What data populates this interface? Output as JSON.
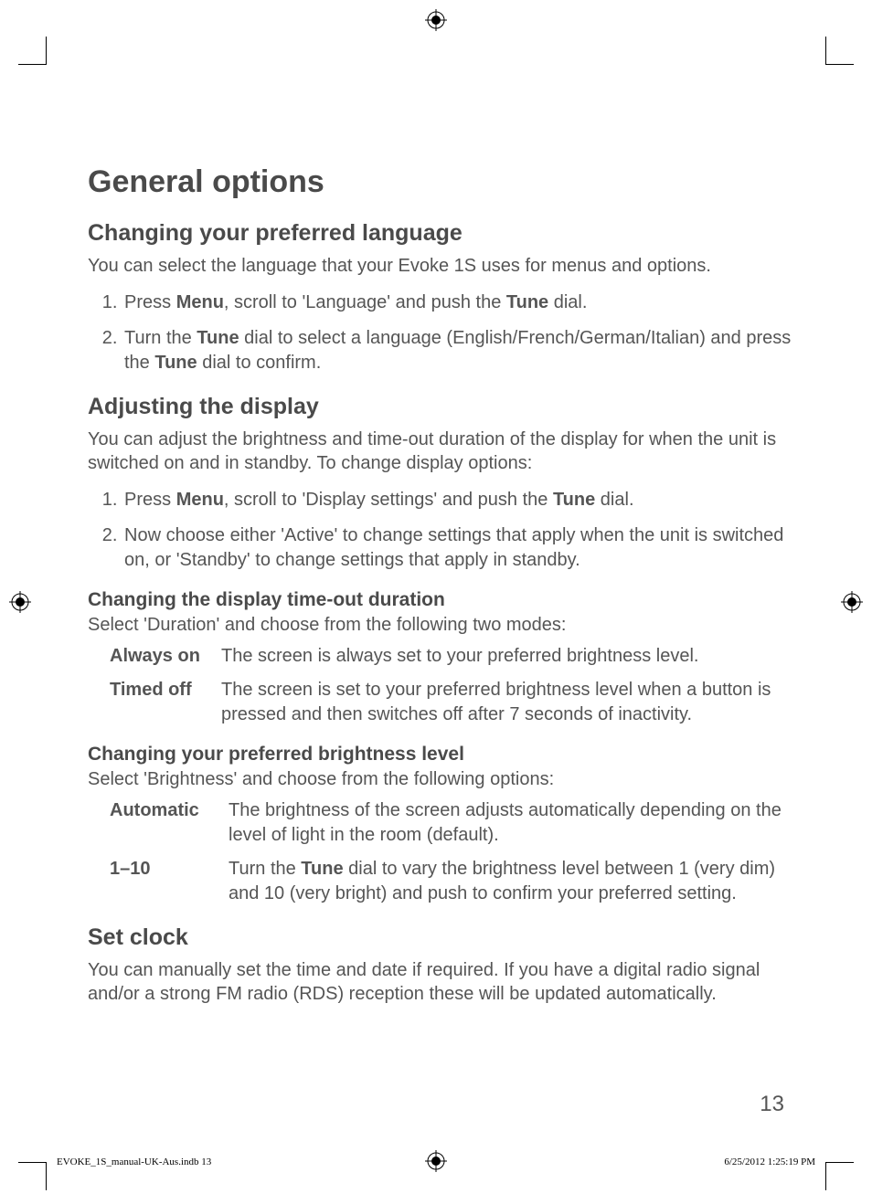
{
  "title": "General options",
  "sections": {
    "lang": {
      "heading": "Changing your preferred language",
      "intro": "You can select the language that your Evoke 1S uses for menus and options.",
      "step1_a": "Press ",
      "step1_b": "Menu",
      "step1_c": ", scroll to 'Language' and push the ",
      "step1_d": "Tune",
      "step1_e": " dial.",
      "step2_a": "Turn the ",
      "step2_b": "Tune",
      "step2_c": " dial to select a language (English/French/German/Italian) and press the ",
      "step2_d": "Tune",
      "step2_e": " dial to confirm."
    },
    "display": {
      "heading": "Adjusting the display",
      "intro": "You can adjust the brightness and time-out duration of the display for when the unit is switched on and in standby. To change display options:",
      "step1_a": "Press ",
      "step1_b": "Menu",
      "step1_c": ", scroll to 'Display settings' and push the ",
      "step1_d": "Tune",
      "step1_e": " dial.",
      "step2": "Now choose either 'Active' to change settings that apply when the unit is switched on, or 'Standby' to change settings that apply in standby.",
      "timeout_heading": "Changing the display time-out duration",
      "timeout_intro": "Select 'Duration' and choose from the following two modes:",
      "mode_always_label": "Always on",
      "mode_always_desc": "The screen is always set to your preferred brightness level.",
      "mode_timed_label": "Timed off",
      "mode_timed_desc": "The screen is set to your preferred brightness level when a button is pressed and then switches off after 7 seconds of inactivity.",
      "brightness_heading": "Changing your preferred brightness level",
      "brightness_intro": "Select 'Brightness' and choose from the following options:",
      "opt_auto_label": "Automatic",
      "opt_auto_desc": "The brightness of the screen adjusts automatically depending on the level of light in the room (default).",
      "opt_range_label": "1–10",
      "opt_range_a": "Turn the ",
      "opt_range_b": "Tune",
      "opt_range_c": " dial to vary the brightness level between 1 (very dim) and 10 (very bright) and push to confirm your preferred setting."
    },
    "clock": {
      "heading": "Set clock",
      "intro": "You can manually set the time and date if required. If you have a digital radio signal and/or a strong FM radio (RDS) reception these will be updated automatically."
    }
  },
  "page_number": "13",
  "footer_left": "EVOKE_1S_manual-UK-Aus.indb   13",
  "footer_right": "6/25/2012   1:25:19 PM"
}
